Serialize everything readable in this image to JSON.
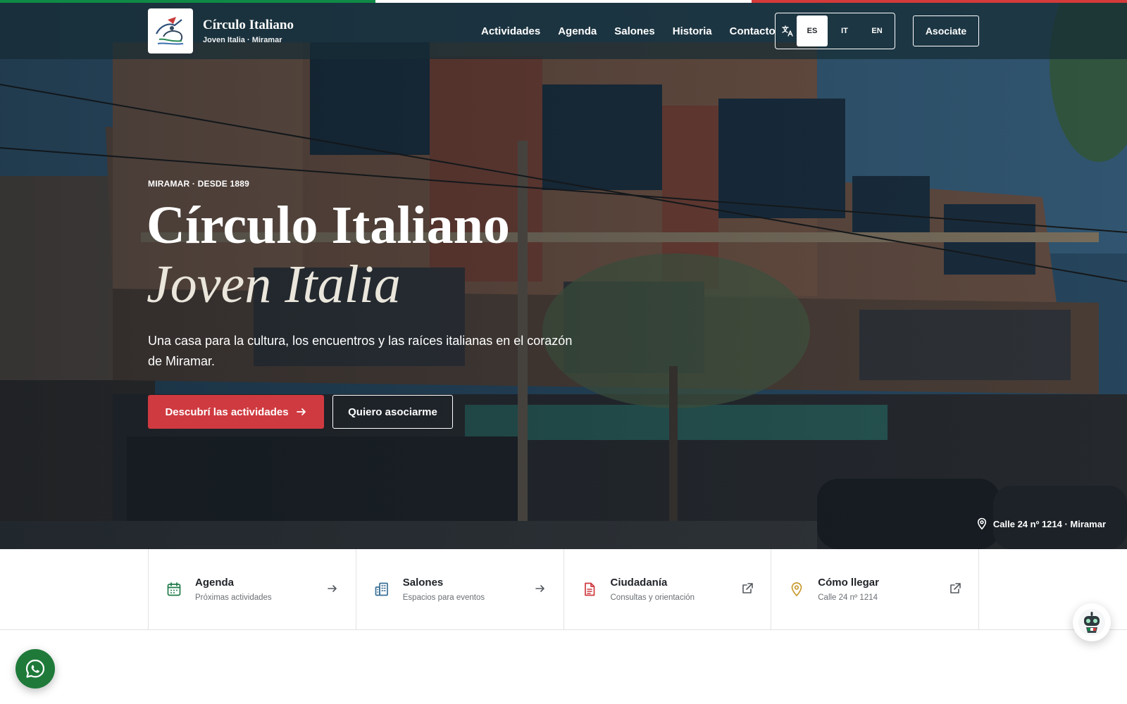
{
  "colors": {
    "italy_green": "#0f8a46",
    "italy_white": "#ffffff",
    "italy_red": "#d43a3a",
    "primary": "#cf3a40",
    "header_bg": "#162c34",
    "green_icon": "#1f7a4a",
    "blue_icon": "#3a6f96",
    "red_icon": "#cf3a40",
    "gold_icon": "#c99a2e"
  },
  "header": {
    "brand_title": "Círculo Italiano",
    "brand_subtitle": "Joven Italia · Miramar",
    "logo_icon": "club-logo",
    "nav": [
      {
        "label": "Actividades"
      },
      {
        "label": "Agenda"
      },
      {
        "label": "Salones"
      },
      {
        "label": "Historia"
      },
      {
        "label": "Contacto"
      }
    ],
    "language": {
      "icon": "translate-icon",
      "options": [
        "ES",
        "IT",
        "EN"
      ],
      "selected": "ES"
    },
    "cta_label": "Asociate"
  },
  "hero": {
    "eyebrow": "MIRAMAR · DESDE 1889",
    "title_line1": "Círculo Italiano",
    "title_line2": "Joven Italia",
    "lead": "Una casa para la cultura, los encuentros y las raíces italianas en el corazón de Miramar.",
    "primary_button": "Descubrí las actividades",
    "secondary_button": "Quiero asociarme",
    "address": "Calle 24 nº 1214 · Miramar"
  },
  "quick_links": [
    {
      "title": "Agenda",
      "subtitle": "Próximas actividades",
      "icon": "calendar-icon",
      "action_icon": "arrow-right-icon"
    },
    {
      "title": "Salones",
      "subtitle": "Espacios para eventos",
      "icon": "building-icon",
      "action_icon": "arrow-right-icon"
    },
    {
      "title": "Ciudadanía",
      "subtitle": "Consultas y orientación",
      "icon": "document-icon",
      "action_icon": "external-link-icon"
    },
    {
      "title": "Cómo llegar",
      "subtitle": "Calle 24 nº 1214",
      "icon": "map-pin-icon",
      "action_icon": "external-link-icon"
    }
  ],
  "floating": {
    "whatsapp_icon": "whatsapp-icon",
    "assistant_icon": "robot-assistant-icon"
  }
}
